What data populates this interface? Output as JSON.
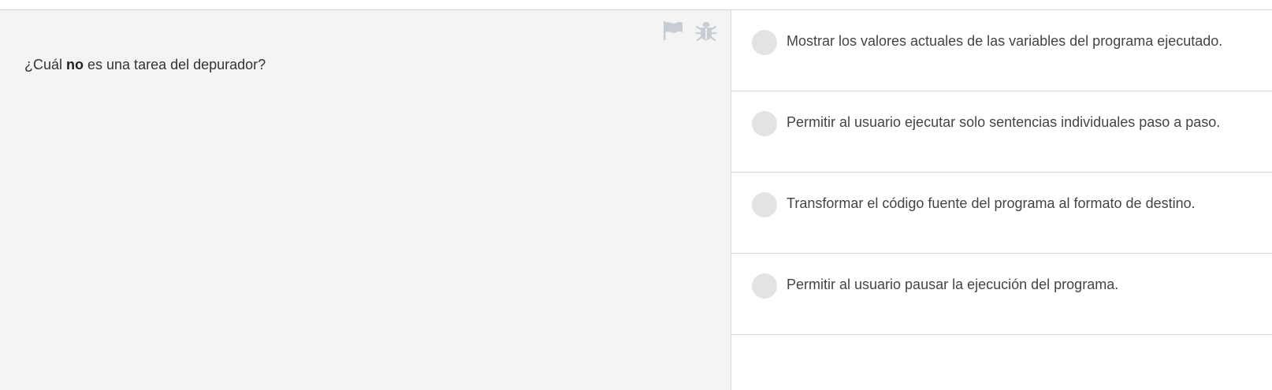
{
  "question": {
    "prefix": "¿Cuál ",
    "emphasis": "no",
    "suffix": " es una tarea del depurador?"
  },
  "tools": {
    "flag_icon": "flag-icon",
    "bug_icon": "bug-icon",
    "icon_color": "#c7cdd3"
  },
  "answers": [
    {
      "label": "Mostrar los valores actuales de las variables del programa ejecutado.",
      "selected": false
    },
    {
      "label": "Permitir al usuario ejecutar solo sentencias individuales paso a paso.",
      "selected": false
    },
    {
      "label": "Transformar el código fuente del programa al formato de destino.",
      "selected": false
    },
    {
      "label": "Permitir al usuario pausar la ejecución del programa.",
      "selected": false
    }
  ],
  "colors": {
    "question_background": "#f4f4f4",
    "radio_unselected": "#e3e3e3",
    "divider": "#d7d7d7"
  }
}
